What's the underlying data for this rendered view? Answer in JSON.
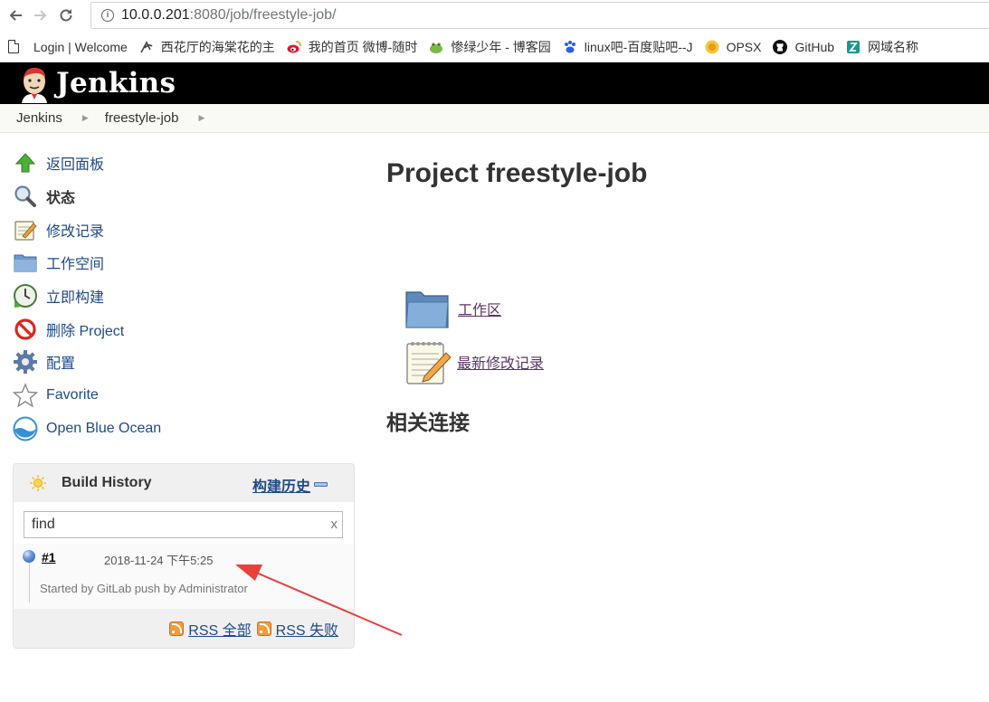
{
  "browser": {
    "url_host": "10.0.0.201",
    "url_rest": ":8080/job/freestyle-job/",
    "bookmarks": [
      {
        "label": "Login | Welcome",
        "icon": "page-icon"
      },
      {
        "label": "西花厅的海棠花的主",
        "icon": "leaf-icon"
      },
      {
        "label": "我的首页 微博-随时",
        "icon": "weibo-icon"
      },
      {
        "label": "惨绿少年 - 博客园",
        "icon": "frog-icon"
      },
      {
        "label": "linux吧-百度贴吧--J",
        "icon": "baidu-paw-icon"
      },
      {
        "label": "OPSX",
        "icon": "opsx-icon"
      },
      {
        "label": "GitHub",
        "icon": "github-icon"
      },
      {
        "label": "网域名称",
        "icon": "domain-icon"
      }
    ]
  },
  "header": {
    "app_title": "Jenkins"
  },
  "breadcrumb": [
    "Jenkins",
    "freestyle-job"
  ],
  "sidebar": {
    "tasks": [
      {
        "label": "返回面板",
        "icon": "up-arrow-icon"
      },
      {
        "label": "状态",
        "icon": "magnifier-icon"
      },
      {
        "label": "修改记录",
        "icon": "notepad-icon"
      },
      {
        "label": "工作空间",
        "icon": "folder-icon"
      },
      {
        "label": "立即构建",
        "icon": "clock-play-icon"
      },
      {
        "label": "删除 Project",
        "icon": "no-entry-icon"
      },
      {
        "label": "配置",
        "icon": "gear-icon"
      },
      {
        "label": "Favorite",
        "icon": "star-icon"
      },
      {
        "label": "Open Blue Ocean",
        "icon": "blue-ocean-icon"
      }
    ]
  },
  "build_history": {
    "title": "Build History",
    "trend_link": "构建历史",
    "search_value": "find",
    "clear_label": "x",
    "builds": [
      {
        "number": "#1",
        "date": "2018-11-24 下午5:25",
        "cause": "Started by GitLab push by Administrator",
        "status": "blue"
      }
    ],
    "rss_all": "RSS 全部",
    "rss_failed": "RSS 失败"
  },
  "main": {
    "title": "Project freestyle-job",
    "links": [
      {
        "label": "工作区",
        "icon": "folder-icon"
      },
      {
        "label": "最新修改记录",
        "icon": "notepad-icon"
      }
    ],
    "related_heading": "相关连接"
  },
  "colors": {
    "link": "#204a87",
    "visited_link": "#5c3566",
    "header_bg": "#000000",
    "annotation_arrow": "#e8413c"
  }
}
